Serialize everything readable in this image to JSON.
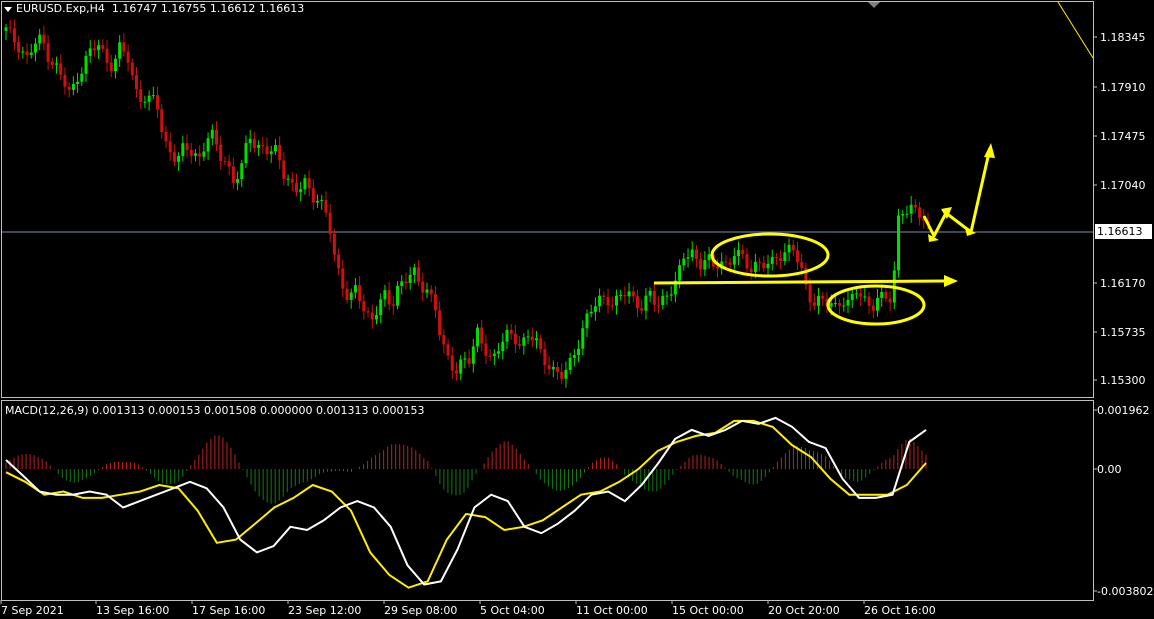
{
  "header": {
    "symbol": "EURUSD.Exp,H4",
    "ohlc": "1.16747 1.16755 1.16612 1.16613"
  },
  "indicator": {
    "label": "MACD(12,26,9) 0.001313 0.000153 0.001508 0.000000 0.001313 0.000153"
  },
  "current_price": "1.16613",
  "colors": {
    "background": "#000000",
    "bull": "#00e000",
    "bear": "#d01010",
    "macd_hist_up": "#c02020",
    "macd_hist_down": "#108010",
    "macd_line": "#ffffff",
    "signal_line": "#ffee00",
    "annotation": "#ffff00",
    "grid_border": "#c0c0c0",
    "price_line": "#7f8fa8"
  },
  "chart_data": [
    {
      "type": "candlestick",
      "symbol": "EURUSD.Exp",
      "timeframe": "H4",
      "ylim": [
        1.1509,
        1.1869
      ],
      "y_ticks": [
        "1.18345",
        "1.17910",
        "1.17475",
        "1.17040",
        "1.16613",
        "1.16170",
        "1.15735",
        "1.15300"
      ],
      "x_ticks": [
        "7 Sep 2021",
        "13 Sep 16:00",
        "17 Sep 16:00",
        "23 Sep 12:00",
        "29 Sep 08:00",
        "5 Oct 04:00",
        "11 Oct 00:00",
        "15 Oct 00:00",
        "20 Oct 20:00",
        "26 Oct 16:00"
      ],
      "close_path": [
        1.184,
        1.1833,
        1.1826,
        1.1815,
        1.1828,
        1.1832,
        1.1818,
        1.1808,
        1.1795,
        1.1782,
        1.18,
        1.1813,
        1.1822,
        1.1827,
        1.1815,
        1.181,
        1.1825,
        1.1816,
        1.179,
        1.1782,
        1.1776,
        1.1781,
        1.1743,
        1.1736,
        1.1722,
        1.1738,
        1.1732,
        1.1728,
        1.1742,
        1.1745,
        1.173,
        1.1722,
        1.1705,
        1.1716,
        1.1752,
        1.1736,
        1.1738,
        1.1728,
        1.1735,
        1.1712,
        1.1703,
        1.1696,
        1.1705,
        1.1695,
        1.1688,
        1.1675,
        1.1635,
        1.162,
        1.16,
        1.1612,
        1.159,
        1.1585,
        1.1596,
        1.1604,
        1.1593,
        1.1616,
        1.1623,
        1.1625,
        1.1611,
        1.161,
        1.16,
        1.156,
        1.1544,
        1.1538,
        1.1552,
        1.1548,
        1.157,
        1.1558,
        1.1549,
        1.156,
        1.1567,
        1.157,
        1.1562,
        1.157,
        1.1565,
        1.155,
        1.1545,
        1.1536,
        1.1532,
        1.1545,
        1.1563,
        1.1582,
        1.1592,
        1.16,
        1.1605,
        1.1598,
        1.1603,
        1.1608,
        1.16,
        1.1597,
        1.1605,
        1.1595,
        1.1603,
        1.1612,
        1.162,
        1.164,
        1.1645,
        1.1632,
        1.164,
        1.1626,
        1.1638,
        1.1631,
        1.1645,
        1.1636,
        1.1629,
        1.1635,
        1.1633,
        1.163,
        1.164,
        1.1645,
        1.165,
        1.163,
        1.161,
        1.16,
        1.1603,
        1.1596,
        1.1593,
        1.1604,
        1.1599,
        1.1608,
        1.16,
        1.1596,
        1.1605,
        1.1601,
        1.16,
        1.1685,
        1.1682,
        1.168,
        1.1675,
        1.1666
      ]
    },
    {
      "type": "line",
      "name": "MACD(12,26,9)",
      "ylim": [
        -0.003802,
        0.001962
      ],
      "y_ticks": [
        "0.001962",
        "0.00",
        "-0.003802"
      ],
      "series": [
        {
          "name": "MACD",
          "values": [
            0.0003,
            -0.0002,
            -0.0007,
            -0.0008,
            -0.0008,
            -0.0007,
            -0.0008,
            -0.0012,
            -0.001,
            -0.0008,
            -0.0006,
            -0.0004,
            -0.0006,
            -0.0012,
            -0.0022,
            -0.0026,
            -0.0024,
            -0.0018,
            -0.0019,
            -0.0016,
            -0.0012,
            -0.001,
            -0.0012,
            -0.0018,
            -0.003,
            -0.0036,
            -0.0035,
            -0.0025,
            -0.0012,
            -0.0008,
            -0.001,
            -0.0018,
            -0.002,
            -0.0017,
            -0.0013,
            -0.0008,
            -0.0007,
            -0.001,
            -0.0005,
            0.0002,
            0.001,
            0.0013,
            0.0011,
            0.0013,
            0.0016,
            0.0015,
            0.0017,
            0.0014,
            0.0009,
            0.0007,
            -0.0003,
            -0.0009,
            -0.0009,
            -0.0008,
            0.0009,
            0.0013
          ]
        },
        {
          "name": "Signal",
          "values": [
            -0.0001,
            -0.0004,
            -0.0008,
            -0.0007,
            -0.0009,
            -0.0009,
            -0.0008,
            -0.0007,
            -0.0005,
            -0.0006,
            -0.0013,
            -0.0023,
            -0.0022,
            -0.0017,
            -0.0012,
            -0.0009,
            -0.0005,
            -0.0007,
            -0.0013,
            -0.0026,
            -0.0033,
            -0.0037,
            -0.0035,
            -0.0022,
            -0.0014,
            -0.0015,
            -0.0019,
            -0.0018,
            -0.0016,
            -0.0012,
            -0.0008,
            -0.0007,
            -0.0004,
            0.0,
            0.0006,
            0.0009,
            0.0011,
            0.0012,
            0.0016,
            0.0016,
            0.0014,
            0.0008,
            0.0004,
            -0.0003,
            -0.0008,
            -0.0008,
            -0.0008,
            -0.0005,
            0.0002
          ]
        }
      ]
    }
  ]
}
